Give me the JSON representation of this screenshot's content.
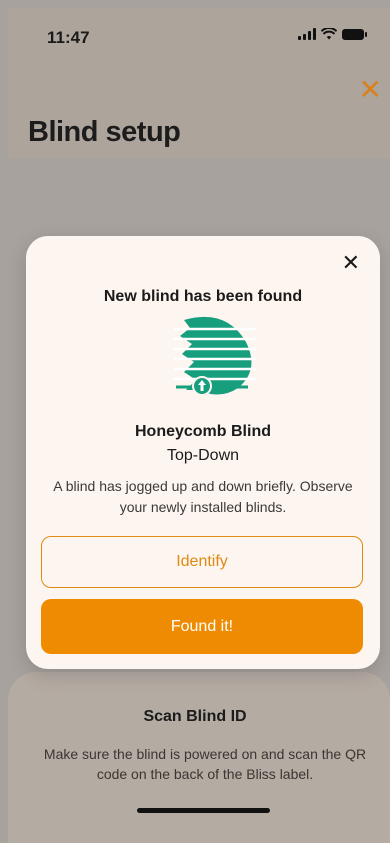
{
  "status_bar": {
    "time": "11:47"
  },
  "header": {
    "title": "Blind setup",
    "close_icon": "close-icon"
  },
  "modal": {
    "title": "New blind has been found",
    "blind_name": "Honeycomb Blind",
    "blind_type": "Top-Down",
    "description": "A blind has jogged up and down briefly. Observe your newly installed blinds.",
    "identify_label": "Identify",
    "found_label": "Found it!"
  },
  "bottom_sheet": {
    "title": "Scan Blind ID",
    "text": "Make sure the blind is powered on and scan the QR code on the back of the Bliss label."
  },
  "colors": {
    "accent": "#ef8b00",
    "icon_green": "#179e7d",
    "modal_bg": "#fdf5f0",
    "overlay": "#a8a29e"
  }
}
